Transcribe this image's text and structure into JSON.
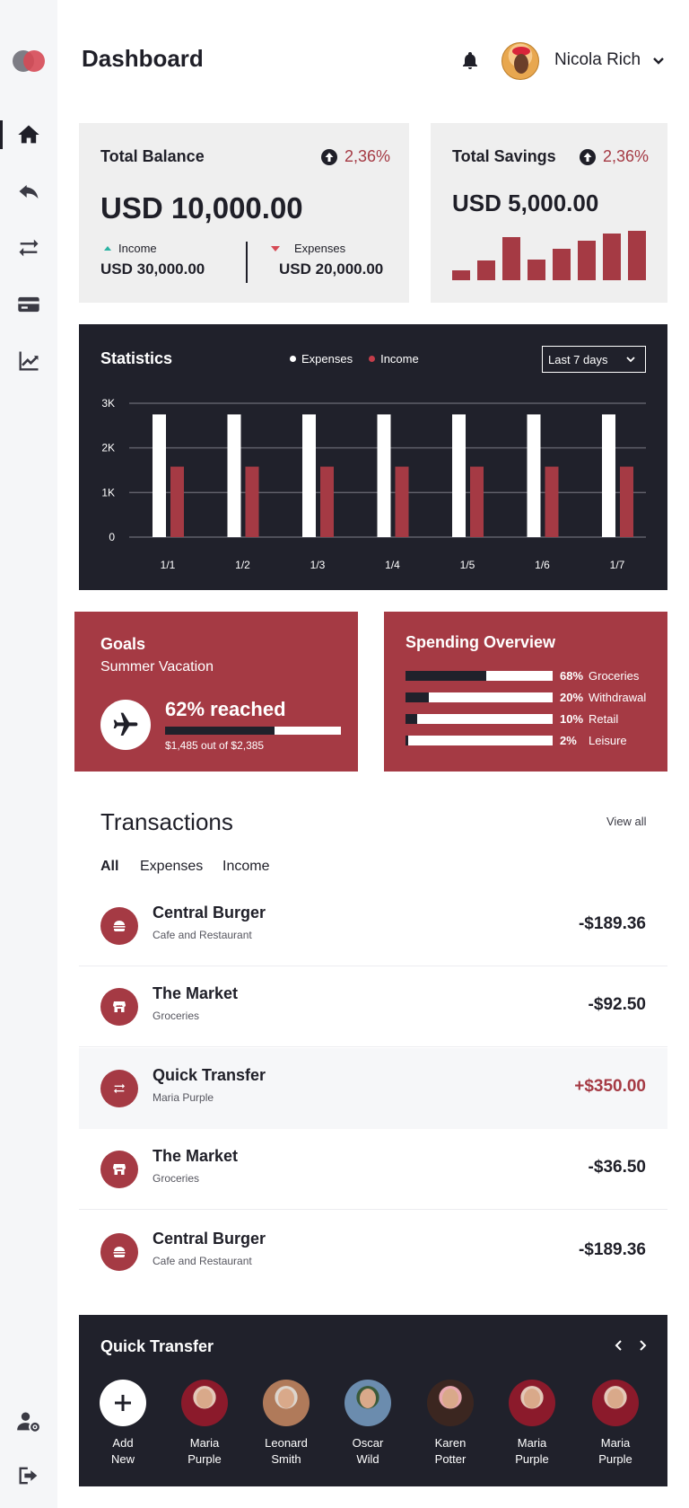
{
  "header": {
    "title": "Dashboard",
    "user_name": "Nicola Rich"
  },
  "sidebar": {
    "items": [
      {
        "icon": "home-icon",
        "active": true
      },
      {
        "icon": "reply-icon"
      },
      {
        "icon": "transfer-icon"
      },
      {
        "icon": "credit-card-icon"
      },
      {
        "icon": "chart-line-icon"
      },
      {
        "icon": "user-settings-icon"
      },
      {
        "icon": "logout-icon"
      }
    ]
  },
  "balance": {
    "title": "Total Balance",
    "change": "2,36%",
    "amount": "USD 10,000.00",
    "income_label": "Income",
    "income_amount": "USD 30,000.00",
    "expenses_label": "Expenses",
    "expenses_amount": "USD 20,000.00"
  },
  "savings": {
    "title": "Total Savings",
    "change": "2,36%",
    "amount": "USD 5,000.00",
    "bars": [
      0.22,
      0.42,
      0.92,
      0.45,
      0.68,
      0.85,
      1.0,
      1.06
    ]
  },
  "statistics": {
    "title": "Statistics",
    "legend_expenses": "Expenses",
    "legend_income": "Income",
    "range": "Last 7 days"
  },
  "chart_data": {
    "type": "bar",
    "categories": [
      "1/1",
      "1/2",
      "1/3",
      "1/4",
      "1/5",
      "1/6",
      "1/7"
    ],
    "series": [
      {
        "name": "Expenses",
        "values": [
          2750,
          2750,
          2750,
          2750,
          2750,
          2750,
          2750
        ],
        "color": "#ffffff"
      },
      {
        "name": "Income",
        "values": [
          1580,
          1580,
          1580,
          1580,
          1580,
          1580,
          1580
        ],
        "color": "#a53a44"
      }
    ],
    "y_ticks": [
      "0",
      "1K",
      "2K",
      "3K"
    ],
    "ylim": [
      0,
      3000
    ],
    "grid": true,
    "legend": "top-center"
  },
  "goals": {
    "title": "Goals",
    "subtitle": "Summer Vacation",
    "reached": "62% reached",
    "progress": 0.62,
    "amount_text": "$1,485 out of $2,385"
  },
  "spending": {
    "title": "Spending Overview",
    "items": [
      {
        "pct": "68%",
        "name": "Groceries",
        "fraction": 0.55
      },
      {
        "pct": "20%",
        "name": "Withdrawal",
        "fraction": 0.16
      },
      {
        "pct": "10%",
        "name": "Retail",
        "fraction": 0.08
      },
      {
        "pct": "2%",
        "name": "Leisure",
        "fraction": 0.02
      }
    ]
  },
  "transactions": {
    "title": "Transactions",
    "view_all": "View all",
    "tabs": [
      "All",
      "Expenses",
      "Income"
    ],
    "rows": [
      {
        "name": "Central Burger",
        "category": "Cafe and Restaurant",
        "amount": "-$189.36",
        "icon": "burger-icon"
      },
      {
        "name": "The Market",
        "category": "Groceries",
        "amount": "-$92.50",
        "icon": "store-icon"
      },
      {
        "name": "Quick Transfer",
        "category": "Maria Purple",
        "amount": "+$350.00",
        "icon": "transfer-icon"
      },
      {
        "name": "The Market",
        "category": "Groceries",
        "amount": "-$36.50",
        "icon": "store-icon"
      },
      {
        "name": "Central Burger",
        "category": "Cafe and Restaurant",
        "amount": "-$189.36",
        "icon": "burger-icon"
      }
    ]
  },
  "quick_transfer": {
    "title": "Quick Transfer",
    "add_first": "Add",
    "add_second": "New",
    "people": [
      {
        "first": "Maria",
        "last": "Purple",
        "colors": [
          "#e3c8b8",
          "#8b1a2b"
        ]
      },
      {
        "first": "Leonard",
        "last": "Smith",
        "colors": [
          "#dcd4cc",
          "#b07a5a"
        ]
      },
      {
        "first": "Oscar",
        "last": "Wild",
        "colors": [
          "#3a5a3a",
          "#6b8cae"
        ]
      },
      {
        "first": "Karen",
        "last": "Potter",
        "colors": [
          "#e8a7b0",
          "#3b2620"
        ]
      },
      {
        "first": "Maria",
        "last": "Purple",
        "colors": [
          "#e3c8b8",
          "#8b1a2b"
        ]
      },
      {
        "first": "Maria",
        "last": "Purple",
        "colors": [
          "#e3c8b8",
          "#8b1a2b"
        ]
      }
    ]
  }
}
